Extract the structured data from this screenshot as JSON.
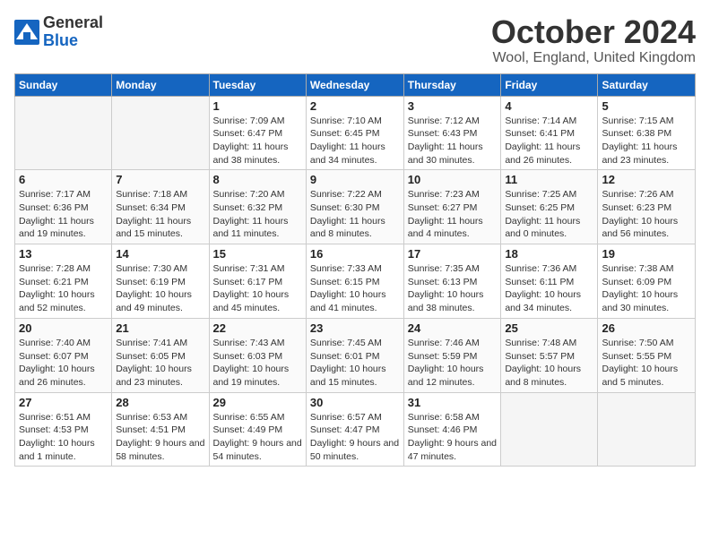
{
  "header": {
    "logo_general": "General",
    "logo_blue": "Blue",
    "month_title": "October 2024",
    "location": "Wool, England, United Kingdom"
  },
  "weekdays": [
    "Sunday",
    "Monday",
    "Tuesday",
    "Wednesday",
    "Thursday",
    "Friday",
    "Saturday"
  ],
  "weeks": [
    [
      {
        "day": "",
        "empty": true
      },
      {
        "day": "",
        "empty": true
      },
      {
        "day": "1",
        "sunrise": "Sunrise: 7:09 AM",
        "sunset": "Sunset: 6:47 PM",
        "daylight": "Daylight: 11 hours and 38 minutes."
      },
      {
        "day": "2",
        "sunrise": "Sunrise: 7:10 AM",
        "sunset": "Sunset: 6:45 PM",
        "daylight": "Daylight: 11 hours and 34 minutes."
      },
      {
        "day": "3",
        "sunrise": "Sunrise: 7:12 AM",
        "sunset": "Sunset: 6:43 PM",
        "daylight": "Daylight: 11 hours and 30 minutes."
      },
      {
        "day": "4",
        "sunrise": "Sunrise: 7:14 AM",
        "sunset": "Sunset: 6:41 PM",
        "daylight": "Daylight: 11 hours and 26 minutes."
      },
      {
        "day": "5",
        "sunrise": "Sunrise: 7:15 AM",
        "sunset": "Sunset: 6:38 PM",
        "daylight": "Daylight: 11 hours and 23 minutes."
      }
    ],
    [
      {
        "day": "6",
        "sunrise": "Sunrise: 7:17 AM",
        "sunset": "Sunset: 6:36 PM",
        "daylight": "Daylight: 11 hours and 19 minutes."
      },
      {
        "day": "7",
        "sunrise": "Sunrise: 7:18 AM",
        "sunset": "Sunset: 6:34 PM",
        "daylight": "Daylight: 11 hours and 15 minutes."
      },
      {
        "day": "8",
        "sunrise": "Sunrise: 7:20 AM",
        "sunset": "Sunset: 6:32 PM",
        "daylight": "Daylight: 11 hours and 11 minutes."
      },
      {
        "day": "9",
        "sunrise": "Sunrise: 7:22 AM",
        "sunset": "Sunset: 6:30 PM",
        "daylight": "Daylight: 11 hours and 8 minutes."
      },
      {
        "day": "10",
        "sunrise": "Sunrise: 7:23 AM",
        "sunset": "Sunset: 6:27 PM",
        "daylight": "Daylight: 11 hours and 4 minutes."
      },
      {
        "day": "11",
        "sunrise": "Sunrise: 7:25 AM",
        "sunset": "Sunset: 6:25 PM",
        "daylight": "Daylight: 11 hours and 0 minutes."
      },
      {
        "day": "12",
        "sunrise": "Sunrise: 7:26 AM",
        "sunset": "Sunset: 6:23 PM",
        "daylight": "Daylight: 10 hours and 56 minutes."
      }
    ],
    [
      {
        "day": "13",
        "sunrise": "Sunrise: 7:28 AM",
        "sunset": "Sunset: 6:21 PM",
        "daylight": "Daylight: 10 hours and 52 minutes."
      },
      {
        "day": "14",
        "sunrise": "Sunrise: 7:30 AM",
        "sunset": "Sunset: 6:19 PM",
        "daylight": "Daylight: 10 hours and 49 minutes."
      },
      {
        "day": "15",
        "sunrise": "Sunrise: 7:31 AM",
        "sunset": "Sunset: 6:17 PM",
        "daylight": "Daylight: 10 hours and 45 minutes."
      },
      {
        "day": "16",
        "sunrise": "Sunrise: 7:33 AM",
        "sunset": "Sunset: 6:15 PM",
        "daylight": "Daylight: 10 hours and 41 minutes."
      },
      {
        "day": "17",
        "sunrise": "Sunrise: 7:35 AM",
        "sunset": "Sunset: 6:13 PM",
        "daylight": "Daylight: 10 hours and 38 minutes."
      },
      {
        "day": "18",
        "sunrise": "Sunrise: 7:36 AM",
        "sunset": "Sunset: 6:11 PM",
        "daylight": "Daylight: 10 hours and 34 minutes."
      },
      {
        "day": "19",
        "sunrise": "Sunrise: 7:38 AM",
        "sunset": "Sunset: 6:09 PM",
        "daylight": "Daylight: 10 hours and 30 minutes."
      }
    ],
    [
      {
        "day": "20",
        "sunrise": "Sunrise: 7:40 AM",
        "sunset": "Sunset: 6:07 PM",
        "daylight": "Daylight: 10 hours and 26 minutes."
      },
      {
        "day": "21",
        "sunrise": "Sunrise: 7:41 AM",
        "sunset": "Sunset: 6:05 PM",
        "daylight": "Daylight: 10 hours and 23 minutes."
      },
      {
        "day": "22",
        "sunrise": "Sunrise: 7:43 AM",
        "sunset": "Sunset: 6:03 PM",
        "daylight": "Daylight: 10 hours and 19 minutes."
      },
      {
        "day": "23",
        "sunrise": "Sunrise: 7:45 AM",
        "sunset": "Sunset: 6:01 PM",
        "daylight": "Daylight: 10 hours and 15 minutes."
      },
      {
        "day": "24",
        "sunrise": "Sunrise: 7:46 AM",
        "sunset": "Sunset: 5:59 PM",
        "daylight": "Daylight: 10 hours and 12 minutes."
      },
      {
        "day": "25",
        "sunrise": "Sunrise: 7:48 AM",
        "sunset": "Sunset: 5:57 PM",
        "daylight": "Daylight: 10 hours and 8 minutes."
      },
      {
        "day": "26",
        "sunrise": "Sunrise: 7:50 AM",
        "sunset": "Sunset: 5:55 PM",
        "daylight": "Daylight: 10 hours and 5 minutes."
      }
    ],
    [
      {
        "day": "27",
        "sunrise": "Sunrise: 6:51 AM",
        "sunset": "Sunset: 4:53 PM",
        "daylight": "Daylight: 10 hours and 1 minute."
      },
      {
        "day": "28",
        "sunrise": "Sunrise: 6:53 AM",
        "sunset": "Sunset: 4:51 PM",
        "daylight": "Daylight: 9 hours and 58 minutes."
      },
      {
        "day": "29",
        "sunrise": "Sunrise: 6:55 AM",
        "sunset": "Sunset: 4:49 PM",
        "daylight": "Daylight: 9 hours and 54 minutes."
      },
      {
        "day": "30",
        "sunrise": "Sunrise: 6:57 AM",
        "sunset": "Sunset: 4:47 PM",
        "daylight": "Daylight: 9 hours and 50 minutes."
      },
      {
        "day": "31",
        "sunrise": "Sunrise: 6:58 AM",
        "sunset": "Sunset: 4:46 PM",
        "daylight": "Daylight: 9 hours and 47 minutes."
      },
      {
        "day": "",
        "empty": true
      },
      {
        "day": "",
        "empty": true
      }
    ]
  ]
}
